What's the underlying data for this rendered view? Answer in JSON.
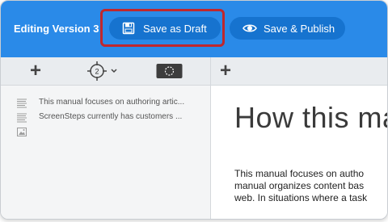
{
  "header": {
    "version_label": "Editing Version 3",
    "save_draft_label": "Save as Draft",
    "save_publish_label": "Save & Publish",
    "draft_icon": "floppy-disk-icon",
    "publish_icon": "eye-icon"
  },
  "toolbar": {
    "badge_count": "2"
  },
  "sidebar": {
    "items": [
      {
        "icon": "document-lines-icon",
        "label": "This manual focuses on authoring artic..."
      },
      {
        "icon": "document-lines-icon",
        "label": "ScreenSteps currently has customers ..."
      }
    ],
    "image_item_icon": "image-icon"
  },
  "content": {
    "title": "How this ma",
    "lines": [
      "This manual focuses on autho",
      "manual organizes content bas",
      "web. In situations where a task"
    ]
  },
  "colors": {
    "header_bg": "#2a8ae8",
    "button_bg": "#1673cf",
    "highlight": "#c0272d"
  }
}
